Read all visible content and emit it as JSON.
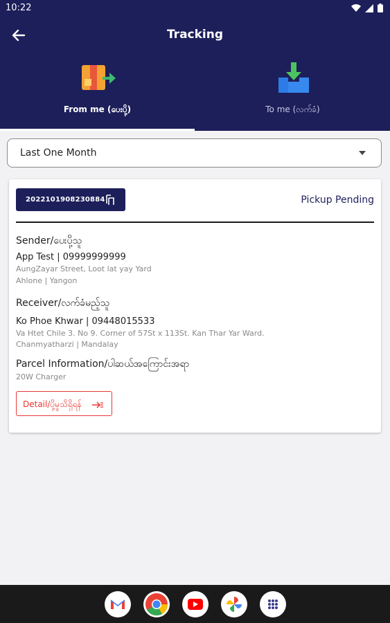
{
  "status_bar": {
    "time": "10:22"
  },
  "header": {
    "title": "Tracking"
  },
  "tabs": [
    {
      "label": "From me (ပေးပို့)"
    },
    {
      "label": "To me (လက်ခံ)"
    }
  ],
  "filter": {
    "selected": "Last One Month"
  },
  "parcel": {
    "tracking_number": "2022101908230884",
    "status": "Pickup Pending",
    "sender": {
      "title": "Sender/ပေးပို့သူ",
      "name_phone": "App Test | 09999999999",
      "street": "AungZayar Street, Loot lat yay Yard",
      "area": "Ahlone | Yangon"
    },
    "receiver": {
      "title": "Receiver/လက်ခံမည့်သူ",
      "name_phone": "Ko Phoe Khwar | 09448015533",
      "street": "Va Htet Chile 3. No 9.  Corner of 57St x 113St. Kan Thar Yar Ward.",
      "area": "Chanmyatharzi | Mandalay"
    },
    "parcel_info": {
      "title": "Parcel Information/ပါဆယ်အကြောင်းအရာ",
      "item": "20W Charger"
    },
    "detail_label": "Detail/ပို့မှုသိရှိရန်"
  },
  "colors": {
    "primary": "#1d1f5a",
    "accent_red": "#e53935"
  },
  "dock": [
    {
      "icon": "gmail-icon"
    },
    {
      "icon": "chrome-icon"
    },
    {
      "icon": "youtube-icon"
    },
    {
      "icon": "photos-icon"
    },
    {
      "icon": "app-drawer-icon"
    }
  ]
}
